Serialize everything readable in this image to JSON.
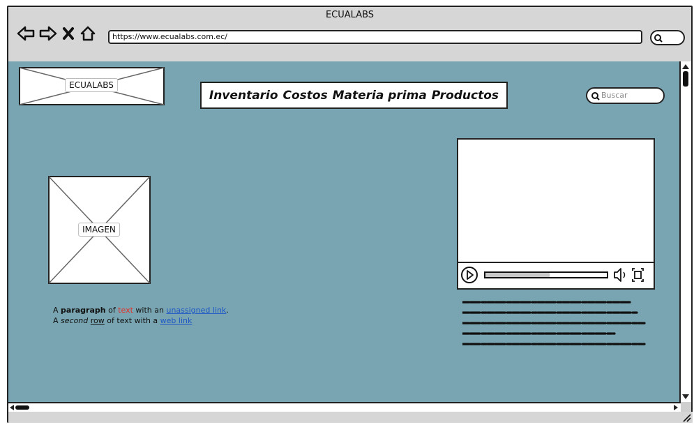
{
  "browser": {
    "title": "ECUALABS",
    "url": "https://www.ecualabs.com.ec/",
    "nav_icons": [
      "back-icon",
      "forward-icon",
      "stop-icon",
      "home-icon"
    ],
    "search_icon": "search-icon"
  },
  "header": {
    "logo_label": "ECUALABS",
    "menu": [
      {
        "label": "Inventario"
      },
      {
        "label": "Costos"
      },
      {
        "label": "Materia prima"
      },
      {
        "label": "Productos"
      }
    ],
    "search_placeholder": "Buscar"
  },
  "main": {
    "image_label": "IMAGEN",
    "paragraph": {
      "line1": {
        "t1": "A ",
        "bold": "paragraph",
        "t2": " of ",
        "red": "text",
        "t3": " with an ",
        "link": "unassigned link",
        "t4": "."
      },
      "line2": {
        "t1": "A ",
        "italic": "second",
        "t2": " ",
        "underline": "row",
        "t3": " of text with a ",
        "link": "web link"
      }
    }
  },
  "video": {
    "controls": [
      "play-icon",
      "volume-icon",
      "fullscreen-icon"
    ],
    "progress": 0.53
  },
  "colors": {
    "content_bg": "#78a5b1",
    "chrome_bg": "#d6d6d6",
    "link": "#1f56c6",
    "red_text": "#e2312a"
  }
}
